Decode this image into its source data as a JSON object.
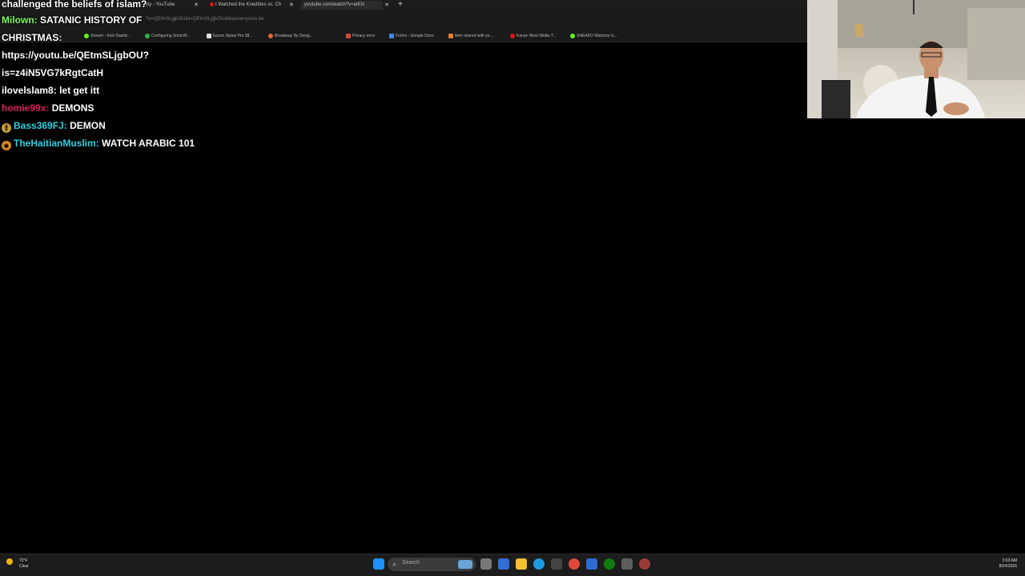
{
  "browser": {
    "tabs": [
      {
        "label": "nity - YouTube",
        "active": false
      },
      {
        "label": "I Watched the Knedittes vs. Ch",
        "active": false
      },
      {
        "label": "youtube.com/watch?v=aIKN",
        "active": true
      }
    ],
    "address_url": "?v=QEtmSLjgbOU&t=QEtmSLjgbOU&feature=youtu.be",
    "bookmarks": [
      "Stream - Kick Dashb...",
      "Configuring SonicW...",
      "Epson Stylus Pro 38...",
      "Broadway By Desig...",
      "Privacy error",
      "Forms - Google Docs",
      "Item shared with yo...",
      "Kanye West Walks T...",
      "SNEAKO Watches G..."
    ]
  },
  "chat": {
    "header": "challenged the beliefs of islam?",
    "messages": [
      {
        "user": "Milown",
        "text": "SATANIC HISTORY OF",
        "user_color": "#7dff5a"
      },
      {
        "user": "",
        "text": "CHRISTMAS:",
        "user_color": "#ffffff"
      },
      {
        "user": "",
        "text": "https://youtu.be/QEtmSLjgbOU?",
        "user_color": "#ffffff"
      },
      {
        "user": "",
        "text": "is=z4iN5VG7kRgtCatH",
        "user_color": "#ffffff"
      },
      {
        "user": "ilovelslam8",
        "text": "let get itt",
        "user_color": "#ffffff"
      },
      {
        "user": "homie99x",
        "text": "DEMONS",
        "user_color": "#e0195a"
      },
      {
        "user": "Bass369FJ",
        "text": "DEMON",
        "user_color": "#29d0e0"
      },
      {
        "user": "TheHaitianMuslim",
        "text": "WATCH ARABIC 101",
        "user_color": "#29d0e0"
      }
    ]
  },
  "taskbar": {
    "weather_temp": "72°F",
    "weather_desc": "Clear",
    "search_placeholder": "Search",
    "time": "3:03 AM",
    "date": "8/24/2026"
  }
}
